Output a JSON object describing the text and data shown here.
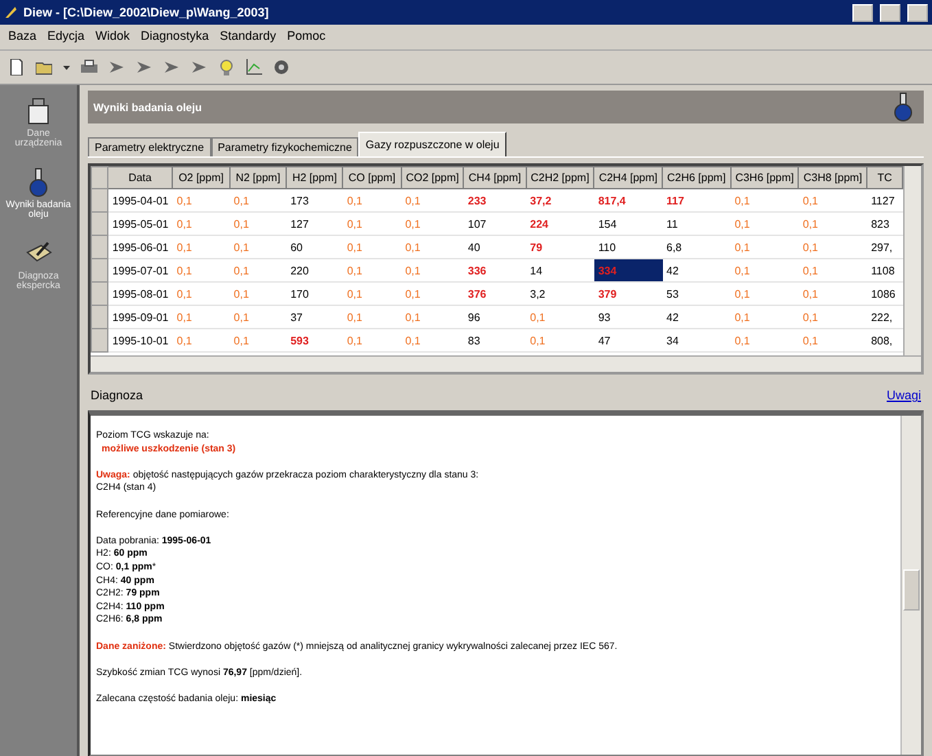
{
  "window": {
    "title": "Diew - [C:\\Diew_2002\\Diew_p\\Wang_2003]"
  },
  "menu": [
    "Baza",
    "Edycja",
    "Widok",
    "Diagnostyka",
    "Standardy",
    "Pomoc"
  ],
  "sidebar": {
    "items": [
      {
        "label": "Dane urządzenia",
        "kind": "transformer",
        "selected": false
      },
      {
        "label": "Wyniki badania oleju",
        "kind": "flask",
        "selected": true
      },
      {
        "label": "Diagnoza ekspercka",
        "kind": "diagnosis",
        "selected": false
      }
    ]
  },
  "panel": {
    "title": "Wyniki badania oleju"
  },
  "tabs": [
    {
      "label": "Parametry elektryczne",
      "selected": false
    },
    {
      "label": "Parametry fizykochemiczne",
      "selected": false
    },
    {
      "label": "Gazy rozpuszczone w oleju",
      "selected": true
    }
  ],
  "table": {
    "columns": [
      "Data",
      "O2 [ppm]",
      "N2 [ppm]",
      "H2 [ppm]",
      "CO [ppm]",
      "CO2 [ppm]",
      "CH4 [ppm]",
      "C2H2 [ppm]",
      "C2H4 [ppm]",
      "C2H6 [ppm]",
      "C3H6 [ppm]",
      "C3H8 [ppm]",
      "TC"
    ],
    "rows": [
      {
        "cells": [
          {
            "value": "1995-04-01",
            "kind": "normal",
            "selected": false
          },
          {
            "value": "0,1",
            "kind": "low",
            "selected": false
          },
          {
            "value": "0,1",
            "kind": "low",
            "selected": false
          },
          {
            "value": "173",
            "kind": "normal",
            "selected": false
          },
          {
            "value": "0,1",
            "kind": "low",
            "selected": false
          },
          {
            "value": "0,1",
            "kind": "low",
            "selected": false
          },
          {
            "value": "233",
            "kind": "high",
            "selected": false
          },
          {
            "value": "37,2",
            "kind": "high",
            "selected": false
          },
          {
            "value": "817,4",
            "kind": "high",
            "selected": false
          },
          {
            "value": "117",
            "kind": "high",
            "selected": false
          },
          {
            "value": "0,1",
            "kind": "low",
            "selected": false
          },
          {
            "value": "0,1",
            "kind": "low",
            "selected": false
          },
          {
            "value": "1127",
            "kind": "normal",
            "selected": false
          }
        ]
      },
      {
        "cells": [
          {
            "value": "1995-05-01",
            "kind": "normal",
            "selected": false
          },
          {
            "value": "0,1",
            "kind": "low",
            "selected": false
          },
          {
            "value": "0,1",
            "kind": "low",
            "selected": false
          },
          {
            "value": "127",
            "kind": "normal",
            "selected": false
          },
          {
            "value": "0,1",
            "kind": "low",
            "selected": false
          },
          {
            "value": "0,1",
            "kind": "low",
            "selected": false
          },
          {
            "value": "107",
            "kind": "normal",
            "selected": false
          },
          {
            "value": "224",
            "kind": "high",
            "selected": false
          },
          {
            "value": "154",
            "kind": "normal",
            "selected": false
          },
          {
            "value": "11",
            "kind": "normal",
            "selected": false
          },
          {
            "value": "0,1",
            "kind": "low",
            "selected": false
          },
          {
            "value": "0,1",
            "kind": "low",
            "selected": false
          },
          {
            "value": "823",
            "kind": "normal",
            "selected": false
          }
        ]
      },
      {
        "cells": [
          {
            "value": "1995-06-01",
            "kind": "normal",
            "selected": false
          },
          {
            "value": "0,1",
            "kind": "low",
            "selected": false
          },
          {
            "value": "0,1",
            "kind": "low",
            "selected": false
          },
          {
            "value": "60",
            "kind": "normal",
            "selected": false
          },
          {
            "value": "0,1",
            "kind": "low",
            "selected": false
          },
          {
            "value": "0,1",
            "kind": "low",
            "selected": false
          },
          {
            "value": "40",
            "kind": "normal",
            "selected": false
          },
          {
            "value": "79",
            "kind": "high",
            "selected": false
          },
          {
            "value": "110",
            "kind": "normal",
            "selected": false
          },
          {
            "value": "6,8",
            "kind": "normal",
            "selected": false
          },
          {
            "value": "0,1",
            "kind": "low",
            "selected": false
          },
          {
            "value": "0,1",
            "kind": "low",
            "selected": false
          },
          {
            "value": "297,",
            "kind": "normal",
            "selected": false
          }
        ]
      },
      {
        "cells": [
          {
            "value": "1995-07-01",
            "kind": "normal",
            "selected": false
          },
          {
            "value": "0,1",
            "kind": "low",
            "selected": false
          },
          {
            "value": "0,1",
            "kind": "low",
            "selected": false
          },
          {
            "value": "220",
            "kind": "normal",
            "selected": false
          },
          {
            "value": "0,1",
            "kind": "low",
            "selected": false
          },
          {
            "value": "0,1",
            "kind": "low",
            "selected": false
          },
          {
            "value": "336",
            "kind": "high",
            "selected": false
          },
          {
            "value": "14",
            "kind": "normal",
            "selected": false
          },
          {
            "value": "334",
            "kind": "high",
            "selected": true
          },
          {
            "value": "42",
            "kind": "normal",
            "selected": false
          },
          {
            "value": "0,1",
            "kind": "low",
            "selected": false
          },
          {
            "value": "0,1",
            "kind": "low",
            "selected": false
          },
          {
            "value": "1108",
            "kind": "normal",
            "selected": false
          }
        ]
      },
      {
        "cells": [
          {
            "value": "1995-08-01",
            "kind": "normal",
            "selected": false
          },
          {
            "value": "0,1",
            "kind": "low",
            "selected": false
          },
          {
            "value": "0,1",
            "kind": "low",
            "selected": false
          },
          {
            "value": "170",
            "kind": "normal",
            "selected": false
          },
          {
            "value": "0,1",
            "kind": "low",
            "selected": false
          },
          {
            "value": "0,1",
            "kind": "low",
            "selected": false
          },
          {
            "value": "376",
            "kind": "high",
            "selected": false
          },
          {
            "value": "3,2",
            "kind": "normal",
            "selected": false
          },
          {
            "value": "379",
            "kind": "high",
            "selected": false
          },
          {
            "value": "53",
            "kind": "normal",
            "selected": false
          },
          {
            "value": "0,1",
            "kind": "low",
            "selected": false
          },
          {
            "value": "0,1",
            "kind": "low",
            "selected": false
          },
          {
            "value": "1086",
            "kind": "normal",
            "selected": false
          }
        ]
      },
      {
        "cells": [
          {
            "value": "1995-09-01",
            "kind": "normal",
            "selected": false
          },
          {
            "value": "0,1",
            "kind": "low",
            "selected": false
          },
          {
            "value": "0,1",
            "kind": "low",
            "selected": false
          },
          {
            "value": "37",
            "kind": "normal",
            "selected": false
          },
          {
            "value": "0,1",
            "kind": "low",
            "selected": false
          },
          {
            "value": "0,1",
            "kind": "low",
            "selected": false
          },
          {
            "value": "96",
            "kind": "normal",
            "selected": false
          },
          {
            "value": "0,1",
            "kind": "low",
            "selected": false
          },
          {
            "value": "93",
            "kind": "normal",
            "selected": false
          },
          {
            "value": "42",
            "kind": "normal",
            "selected": false
          },
          {
            "value": "0,1",
            "kind": "low",
            "selected": false
          },
          {
            "value": "0,1",
            "kind": "low",
            "selected": false
          },
          {
            "value": "222,",
            "kind": "normal",
            "selected": false
          }
        ]
      },
      {
        "cells": [
          {
            "value": "1995-10-01",
            "kind": "normal",
            "selected": false
          },
          {
            "value": "0,1",
            "kind": "low",
            "selected": false
          },
          {
            "value": "0,1",
            "kind": "low",
            "selected": false
          },
          {
            "value": "593",
            "kind": "high",
            "selected": false
          },
          {
            "value": "0,1",
            "kind": "low",
            "selected": false
          },
          {
            "value": "0,1",
            "kind": "low",
            "selected": false
          },
          {
            "value": "83",
            "kind": "normal",
            "selected": false
          },
          {
            "value": "0,1",
            "kind": "low",
            "selected": false
          },
          {
            "value": "47",
            "kind": "normal",
            "selected": false
          },
          {
            "value": "34",
            "kind": "normal",
            "selected": false
          },
          {
            "value": "0,1",
            "kind": "low",
            "selected": false
          },
          {
            "value": "0,1",
            "kind": "low",
            "selected": false
          },
          {
            "value": "808,",
            "kind": "normal",
            "selected": false
          }
        ]
      }
    ]
  },
  "diagnosis": {
    "title": "Diagnoza",
    "link": "Uwagi",
    "lines": [
      {
        "kind": "text",
        "text": "Poziom TCG wskazuje na:"
      },
      {
        "kind": "warning",
        "text": "możliwe uszkodzenie (stan 3)"
      },
      {
        "kind": "gap"
      },
      {
        "kind": "text",
        "label": "Uwaga:",
        "text": "objętość następujących gazów przekracza poziom charakterystyczny dla stanu 3:"
      },
      {
        "kind": "text",
        "text": "C2H4 (stan 4)"
      },
      {
        "kind": "gap"
      },
      {
        "kind": "text",
        "text": "Referencyjne dane pomiarowe:"
      },
      {
        "kind": "gap"
      },
      {
        "kind": "text",
        "text": "Data pobrania: **1995-06-01**"
      },
      {
        "kind": "text",
        "text": "H2: **60 ppm**"
      },
      {
        "kind": "text",
        "text": "CO: **0,1 ppm***"
      },
      {
        "kind": "text",
        "text": "CH4: **40 ppm**"
      },
      {
        "kind": "text",
        "text": "C2H2: **79 ppm**"
      },
      {
        "kind": "text",
        "text": "C2H4: **110 ppm**"
      },
      {
        "kind": "text",
        "text": "C2H6: **6,8 ppm**"
      },
      {
        "kind": "gap"
      },
      {
        "kind": "text",
        "label": "Dane zaniżone:",
        "text": "Stwierdzono objętość gazów (*) mniejszą od analitycznej granicy wykrywalności zalecanej przez IEC 567."
      },
      {
        "kind": "gap"
      },
      {
        "kind": "text",
        "text": "Szybkość zmian TCG wynosi **76,97** [ppm/dzień]."
      },
      {
        "kind": "gap"
      },
      {
        "kind": "text",
        "text": "Zalecana częstość badania oleju: **miesiąc**"
      }
    ]
  }
}
